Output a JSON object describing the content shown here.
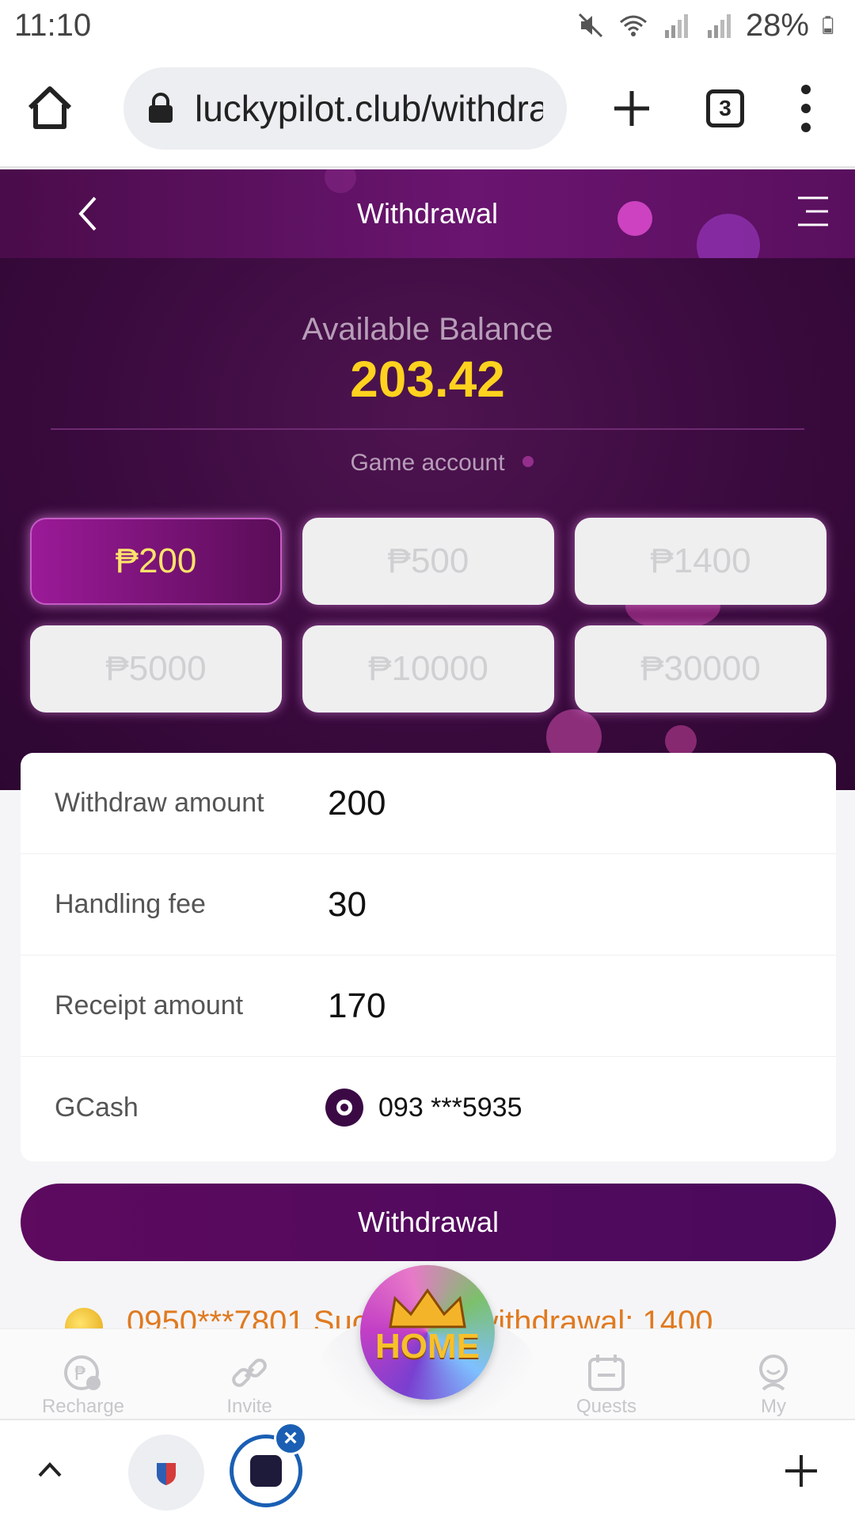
{
  "status_bar": {
    "time": "11:10",
    "battery": "28%"
  },
  "browser": {
    "url": "luckypilot.club/withdra",
    "tab_count": "3"
  },
  "header": {
    "title": "Withdrawal"
  },
  "balance": {
    "label": "Available Balance",
    "value": "203.42",
    "account_label": "Game account"
  },
  "amount_options": [
    {
      "label": "₱200",
      "selected": true
    },
    {
      "label": "₱500",
      "selected": false
    },
    {
      "label": "₱1400",
      "selected": false
    },
    {
      "label": "₱5000",
      "selected": false
    },
    {
      "label": "₱10000",
      "selected": false
    },
    {
      "label": "₱30000",
      "selected": false
    }
  ],
  "details": {
    "withdraw_amount_label": "Withdraw amount",
    "withdraw_amount_value": "200",
    "handling_fee_label": "Handling fee",
    "handling_fee_value": "30",
    "receipt_amount_label": "Receipt amount",
    "receipt_amount_value": "170",
    "gcash_label": "GCash",
    "gcash_number": "093 ***5935"
  },
  "withdraw_button": "Withdrawal",
  "ticker": "0950***7801 Successful withdrawal: 1400",
  "nav": {
    "recharge": "Recharge",
    "invite": "Invite",
    "home": "HOME",
    "quests": "Quests",
    "my": "My"
  },
  "colors": {
    "accent_purple": "#5d0a5f",
    "balance_yellow": "#ffd21f",
    "selected_text": "#ffe36b"
  }
}
